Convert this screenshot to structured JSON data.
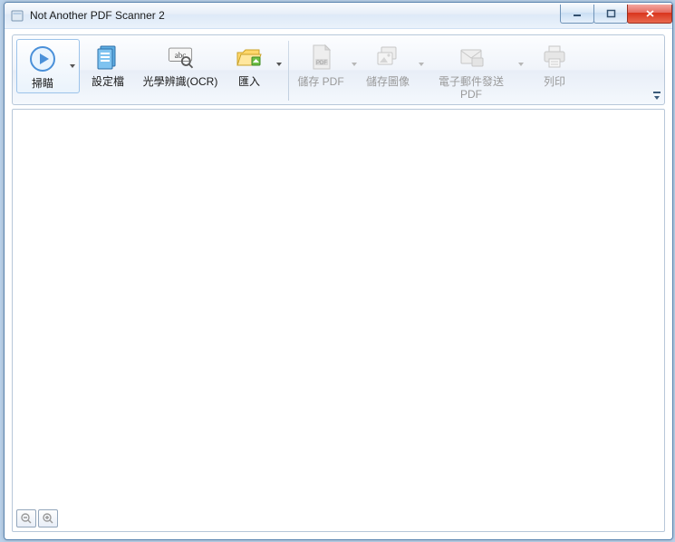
{
  "window": {
    "title": "Not Another PDF Scanner 2"
  },
  "toolbar": {
    "scan": {
      "label": "掃瞄",
      "enabled": true,
      "has_dropdown": true
    },
    "profiles": {
      "label": "設定檔",
      "enabled": true
    },
    "ocr": {
      "label": "光學辨識(OCR)",
      "enabled": true
    },
    "import": {
      "label": "匯入",
      "enabled": true,
      "has_dropdown": true
    },
    "save_pdf": {
      "label": "儲存 PDF",
      "enabled": false,
      "has_dropdown": true
    },
    "save_image": {
      "label": "儲存圖像",
      "enabled": false,
      "has_dropdown": true
    },
    "email_pdf": {
      "label": "電子郵件發送 PDF",
      "enabled": false,
      "has_dropdown": true
    },
    "print": {
      "label": "列印",
      "enabled": false
    }
  },
  "zoom": {
    "out_enabled": false,
    "in_enabled": false
  }
}
